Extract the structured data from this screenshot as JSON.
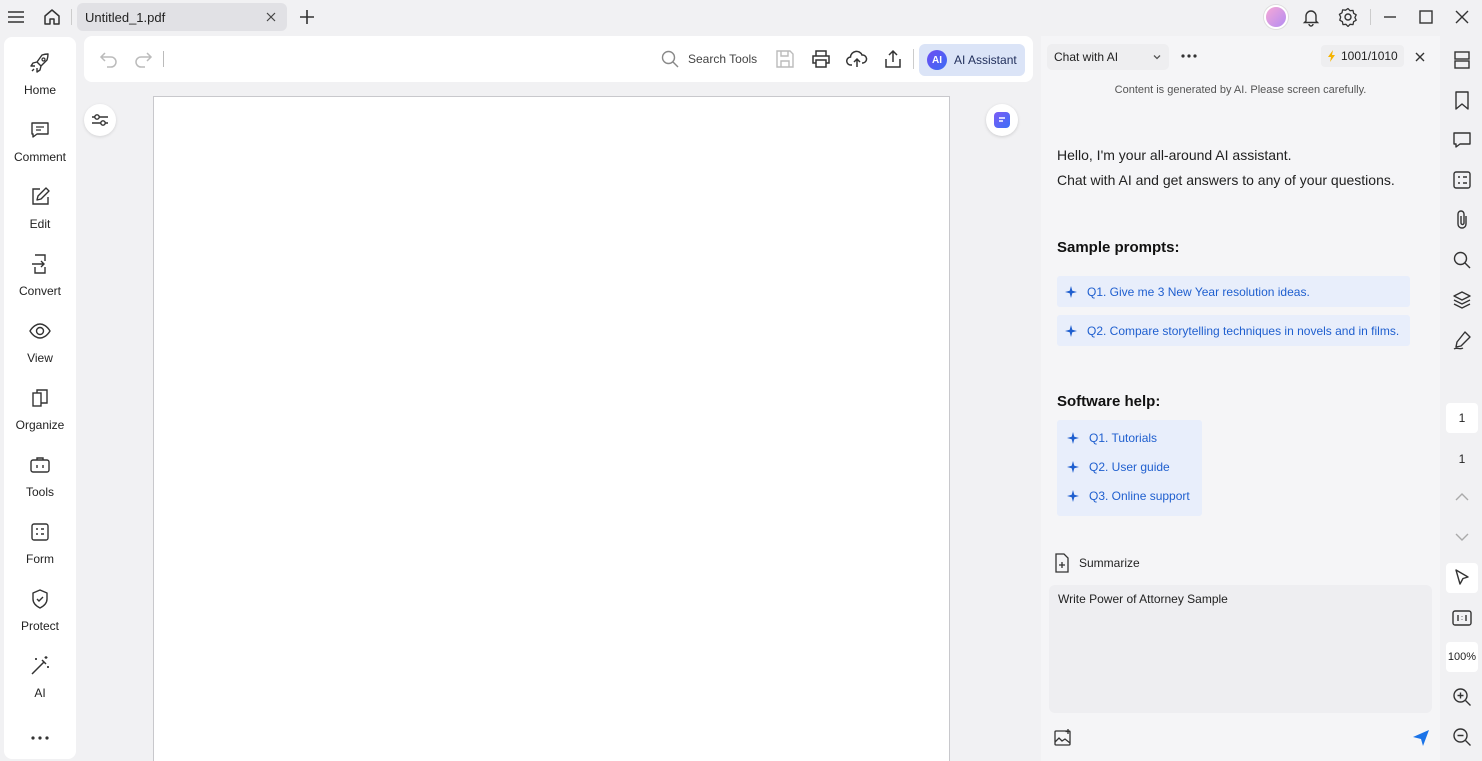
{
  "titlebar": {
    "tab_title": "Untitled_1.pdf"
  },
  "left_sidebar": {
    "items": [
      {
        "label": "Home",
        "icon": "rocket-icon"
      },
      {
        "label": "Comment",
        "icon": "comment-icon"
      },
      {
        "label": "Edit",
        "icon": "edit-icon"
      },
      {
        "label": "Convert",
        "icon": "convert-icon"
      },
      {
        "label": "View",
        "icon": "eye-icon"
      },
      {
        "label": "Organize",
        "icon": "organize-icon"
      },
      {
        "label": "Tools",
        "icon": "toolbox-icon"
      },
      {
        "label": "Form",
        "icon": "form-icon"
      },
      {
        "label": "Protect",
        "icon": "shield-icon"
      },
      {
        "label": "AI",
        "icon": "magic-wand-icon"
      }
    ]
  },
  "toolbar": {
    "search_label": "Search Tools",
    "ai_button_label": "AI Assistant",
    "ai_logo_text": "AI"
  },
  "ai_panel": {
    "mode_label": "Chat with AI",
    "quota": "1001/1010",
    "notice": "Content is generated by AI. Please screen carefully.",
    "greeting_line1": "Hello, I'm your all-around AI assistant.",
    "greeting_line2": "Chat with AI and get answers to any of your questions.",
    "sample_prompts_title": "Sample prompts:",
    "sample_prompts": [
      "Q1. Give me 3 New Year resolution ideas.",
      "Q2. Compare storytelling techniques in novels and in films."
    ],
    "software_help_title": "Software help:",
    "software_help": [
      "Q1. Tutorials",
      "Q2. User guide",
      "Q3. Online support"
    ],
    "summarize_label": "Summarize",
    "input_value": "Write Power of Attorney Sample"
  },
  "right_rail": {
    "current_page": "1",
    "total_pages": "1",
    "zoom": "100%"
  },
  "colors": {
    "accent": "#1f5fcf",
    "ai_button_bg": "#dbe4f7",
    "send": "#1a73e8"
  }
}
